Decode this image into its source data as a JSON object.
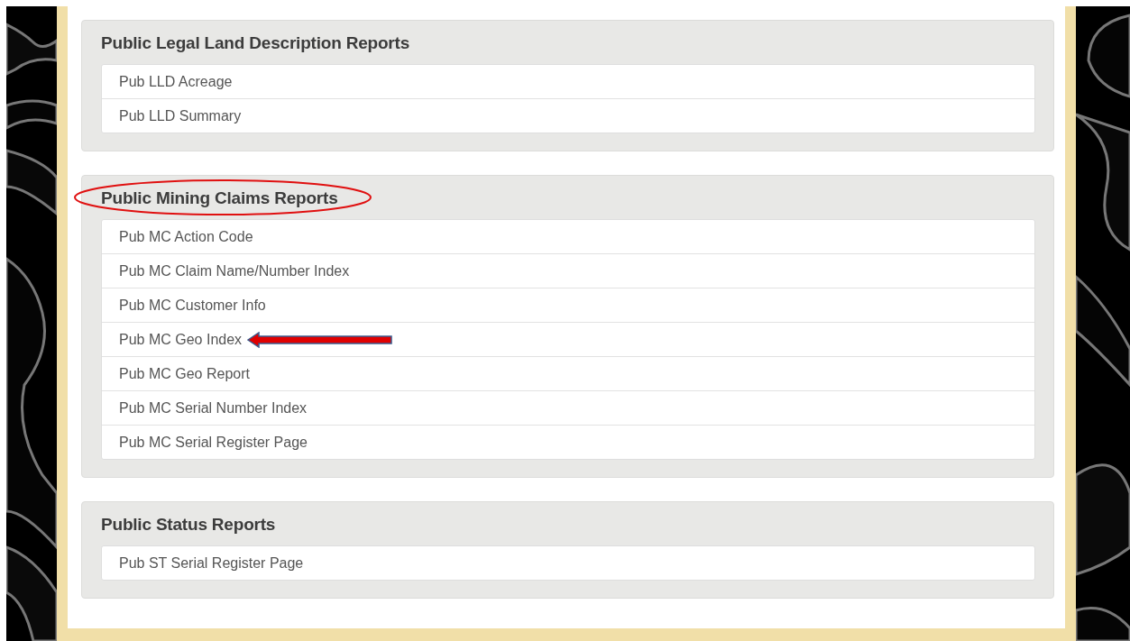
{
  "sections": [
    {
      "title": "Public Legal Land Description Reports",
      "circled": false,
      "items": [
        {
          "label": "Pub LLD Acreage",
          "arrow": false
        },
        {
          "label": "Pub LLD Summary",
          "arrow": false
        }
      ]
    },
    {
      "title": "Public Mining Claims Reports",
      "circled": true,
      "items": [
        {
          "label": "Pub MC Action Code",
          "arrow": false
        },
        {
          "label": "Pub MC Claim Name/Number Index",
          "arrow": false
        },
        {
          "label": "Pub MC Customer Info",
          "arrow": false
        },
        {
          "label": "Pub MC Geo Index",
          "arrow": true
        },
        {
          "label": "Pub MC Geo Report",
          "arrow": false
        },
        {
          "label": "Pub MC Serial Number Index",
          "arrow": false
        },
        {
          "label": "Pub MC Serial Register Page",
          "arrow": false
        }
      ]
    },
    {
      "title": "Public Status Reports",
      "circled": false,
      "items": [
        {
          "label": "Pub ST Serial Register Page",
          "arrow": false
        }
      ]
    }
  ]
}
